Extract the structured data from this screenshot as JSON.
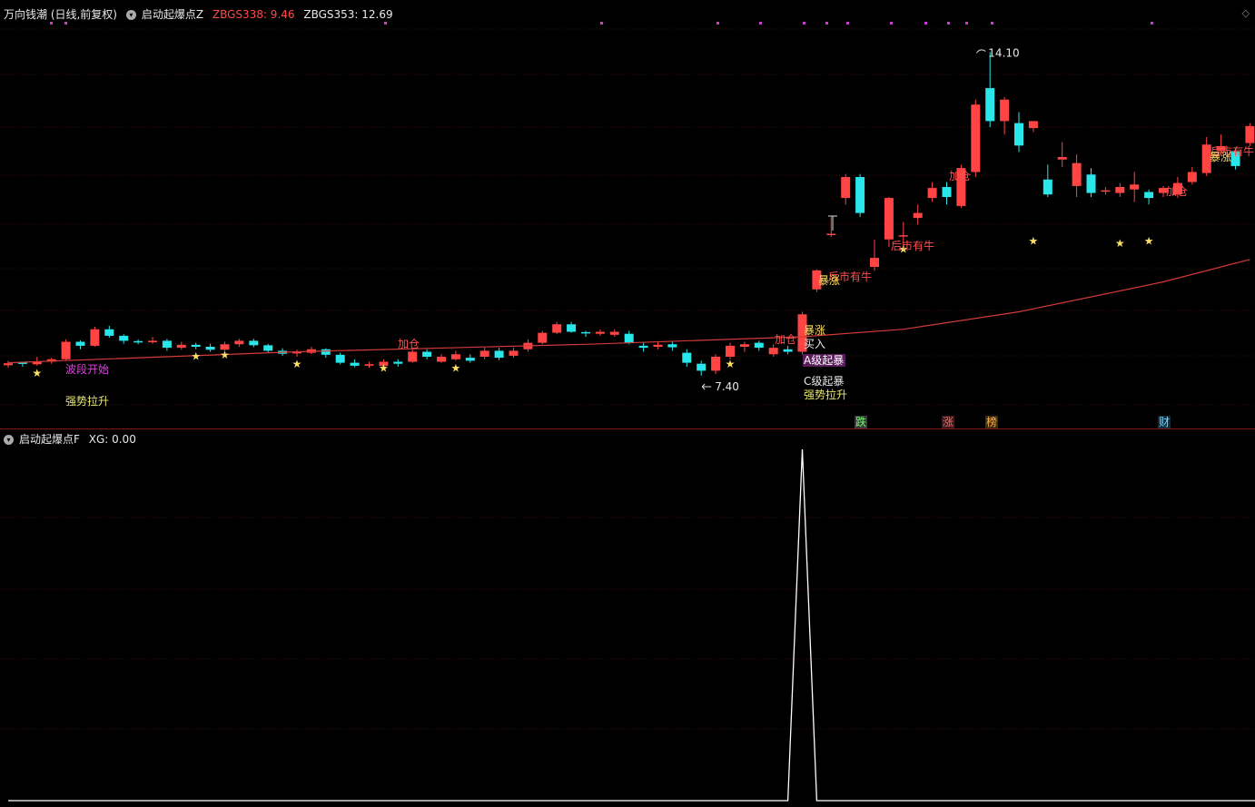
{
  "main": {
    "title": "万向钱潮 (日线,前复权)",
    "indicator": "启动起爆点Z",
    "ind1_label": "ZBGS338: 9.46",
    "ind2_label": "ZBGS353: 12.69",
    "diamond_icon": "diamond-icon"
  },
  "sub": {
    "indicator": "启动起爆点F",
    "value_label": "XG: 0.00"
  },
  "colors": {
    "up": "#ff4444",
    "down": "#29e6ea",
    "ma": "#d23a3a",
    "grid": "#3a0d0d"
  },
  "chart_data": {
    "type": "candlestick",
    "title": "万向钱潮 (日线,前复权)",
    "high_label": "14.10",
    "low_label": "7.40",
    "price_range": [
      6.6,
      14.6
    ],
    "candles": [
      [
        7.83,
        7.87,
        7.92,
        7.78
      ],
      [
        7.87,
        7.85,
        7.9,
        7.8
      ],
      [
        7.85,
        7.9,
        8.0,
        7.82
      ],
      [
        7.9,
        7.95,
        7.98,
        7.86
      ],
      [
        7.95,
        8.3,
        8.35,
        7.93
      ],
      [
        8.3,
        8.22,
        8.33,
        8.15
      ],
      [
        8.22,
        8.55,
        8.6,
        8.2
      ],
      [
        8.55,
        8.42,
        8.62,
        8.38
      ],
      [
        8.42,
        8.32,
        8.45,
        8.26
      ],
      [
        8.3,
        8.29,
        8.35,
        8.25
      ],
      [
        8.29,
        8.32,
        8.4,
        8.26
      ],
      [
        8.32,
        8.18,
        8.36,
        8.12
      ],
      [
        8.18,
        8.24,
        8.3,
        8.14
      ],
      [
        8.24,
        8.2,
        8.28,
        8.15
      ],
      [
        8.2,
        8.14,
        8.26,
        8.1
      ],
      [
        8.14,
        8.25,
        8.3,
        8.12
      ],
      [
        8.25,
        8.32,
        8.36,
        8.2
      ],
      [
        8.32,
        8.23,
        8.36,
        8.19
      ],
      [
        8.23,
        8.12,
        8.26,
        8.08
      ],
      [
        8.12,
        8.06,
        8.17,
        8.02
      ],
      [
        8.06,
        8.08,
        8.14,
        8.0
      ],
      [
        8.08,
        8.15,
        8.2,
        8.05
      ],
      [
        8.15,
        8.04,
        8.17,
        7.98
      ],
      [
        8.04,
        7.88,
        8.08,
        7.85
      ],
      [
        7.88,
        7.82,
        7.95,
        7.79
      ],
      [
        7.82,
        7.85,
        7.9,
        7.78
      ],
      [
        7.82,
        7.9,
        7.95,
        7.8
      ],
      [
        7.9,
        7.86,
        7.95,
        7.8
      ],
      [
        7.9,
        8.1,
        8.15,
        7.88
      ],
      [
        8.1,
        8.0,
        8.15,
        7.95
      ],
      [
        7.9,
        8.0,
        8.05,
        7.88
      ],
      [
        7.95,
        8.05,
        8.12,
        7.92
      ],
      [
        7.98,
        7.92,
        8.05,
        7.88
      ],
      [
        8.0,
        8.12,
        8.18,
        7.95
      ],
      [
        8.12,
        7.98,
        8.18,
        7.93
      ],
      [
        8.02,
        8.12,
        8.18,
        7.98
      ],
      [
        8.15,
        8.28,
        8.35,
        8.1
      ],
      [
        8.28,
        8.48,
        8.52,
        8.25
      ],
      [
        8.48,
        8.65,
        8.7,
        8.45
      ],
      [
        8.65,
        8.5,
        8.7,
        8.48
      ],
      [
        8.48,
        8.46,
        8.52,
        8.4
      ],
      [
        8.46,
        8.5,
        8.55,
        8.42
      ],
      [
        8.44,
        8.5,
        8.55,
        8.4
      ],
      [
        8.46,
        8.28,
        8.52,
        8.25
      ],
      [
        8.22,
        8.18,
        8.3,
        8.1
      ],
      [
        8.2,
        8.24,
        8.3,
        8.15
      ],
      [
        8.25,
        8.19,
        8.3,
        8.12
      ],
      [
        8.08,
        7.88,
        8.15,
        7.8
      ],
      [
        7.86,
        7.72,
        7.92,
        7.62
      ],
      [
        7.72,
        8.0,
        8.05,
        7.65
      ],
      [
        8.0,
        8.22,
        8.28,
        7.95
      ],
      [
        8.2,
        8.25,
        8.3,
        8.1
      ],
      [
        8.28,
        8.18,
        8.32,
        8.12
      ],
      [
        8.05,
        8.18,
        8.25,
        8.0
      ],
      [
        8.15,
        8.1,
        8.22,
        8.05
      ],
      [
        8.1,
        8.85,
        8.9,
        8.05
      ],
      [
        9.35,
        9.73,
        9.75,
        9.3
      ],
      [
        10.43,
        10.45,
        10.8,
        10.4
      ],
      [
        11.18,
        11.6,
        11.66,
        11.05
      ],
      [
        11.6,
        10.88,
        11.66,
        10.8
      ],
      [
        9.8,
        9.98,
        10.35,
        9.72
      ],
      [
        10.35,
        11.18,
        11.2,
        10.2
      ],
      [
        10.42,
        10.42,
        10.7,
        10.2
      ],
      [
        10.78,
        10.88,
        11.05,
        10.65
      ],
      [
        11.18,
        11.38,
        11.5,
        11.1
      ],
      [
        11.4,
        11.2,
        11.5,
        11.05
      ],
      [
        11.02,
        11.78,
        11.85,
        10.98
      ],
      [
        11.7,
        13.05,
        13.15,
        11.6
      ],
      [
        13.38,
        12.72,
        14.1,
        12.6
      ],
      [
        12.72,
        13.15,
        13.2,
        12.45
      ],
      [
        12.68,
        12.23,
        12.9,
        12.1
      ],
      [
        12.58,
        12.72,
        12.72,
        12.5
      ],
      [
        11.55,
        11.25,
        11.85,
        11.2
      ],
      [
        11.95,
        12.0,
        12.3,
        11.8
      ],
      [
        11.42,
        11.88,
        12.05,
        11.2
      ],
      [
        11.65,
        11.28,
        11.78,
        11.2
      ],
      [
        11.32,
        11.32,
        11.4,
        11.25
      ],
      [
        11.28,
        11.4,
        11.48,
        11.2
      ],
      [
        11.35,
        11.45,
        11.7,
        11.1
      ],
      [
        11.3,
        11.18,
        11.35,
        11.05
      ],
      [
        11.28,
        11.38,
        11.42,
        11.2
      ],
      [
        11.25,
        11.48,
        11.6,
        11.18
      ],
      [
        11.5,
        11.7,
        11.8,
        11.45
      ],
      [
        11.68,
        12.25,
        12.4,
        11.62
      ],
      [
        12.12,
        12.22,
        12.45,
        12.05
      ],
      [
        12.12,
        11.82,
        12.18,
        11.75
      ],
      [
        12.28,
        12.62,
        12.68,
        12.22
      ]
    ],
    "ma_line": [
      [
        7.88,
        0
      ],
      [
        8.1,
        20
      ],
      [
        8.25,
        40
      ],
      [
        8.4,
        55
      ],
      [
        8.55,
        62
      ],
      [
        8.9,
        70
      ],
      [
        9.5,
        80
      ],
      [
        9.95,
        86
      ]
    ],
    "xg_series": [
      0,
      0,
      0,
      0,
      0,
      0,
      0,
      0,
      0,
      0,
      0,
      0,
      0,
      0,
      0,
      0,
      0,
      0,
      0,
      0,
      0,
      0,
      0,
      0,
      0,
      0,
      0,
      0,
      0,
      0,
      0,
      0,
      0,
      0,
      0,
      0,
      0,
      0,
      0,
      0,
      0,
      0,
      0,
      0,
      0,
      0,
      0,
      0,
      0,
      0,
      0,
      0,
      0,
      0,
      0,
      1,
      0,
      0,
      0,
      0,
      0,
      0,
      0,
      0,
      0,
      0,
      0,
      0,
      0,
      0,
      0,
      0,
      0,
      0,
      0,
      0,
      0,
      0,
      0,
      0,
      0,
      0,
      0,
      0,
      0,
      0,
      0,
      0
    ],
    "xg_range": [
      0,
      1
    ],
    "annotations": {
      "bodaun_start": "波段开始",
      "strong_rise": "强势拉升",
      "add_pos": "加仓",
      "surge": "暴涨",
      "buy_in": "买入",
      "a_level": "A级起暴",
      "c_level": "C级起暴",
      "strong_rise2": "强势拉升",
      "bull_later": "后市有牛",
      "star": "★"
    },
    "bottom_tags": {
      "fall": "跌",
      "rise": "涨",
      "grab": "榜",
      "finance": "财"
    }
  }
}
